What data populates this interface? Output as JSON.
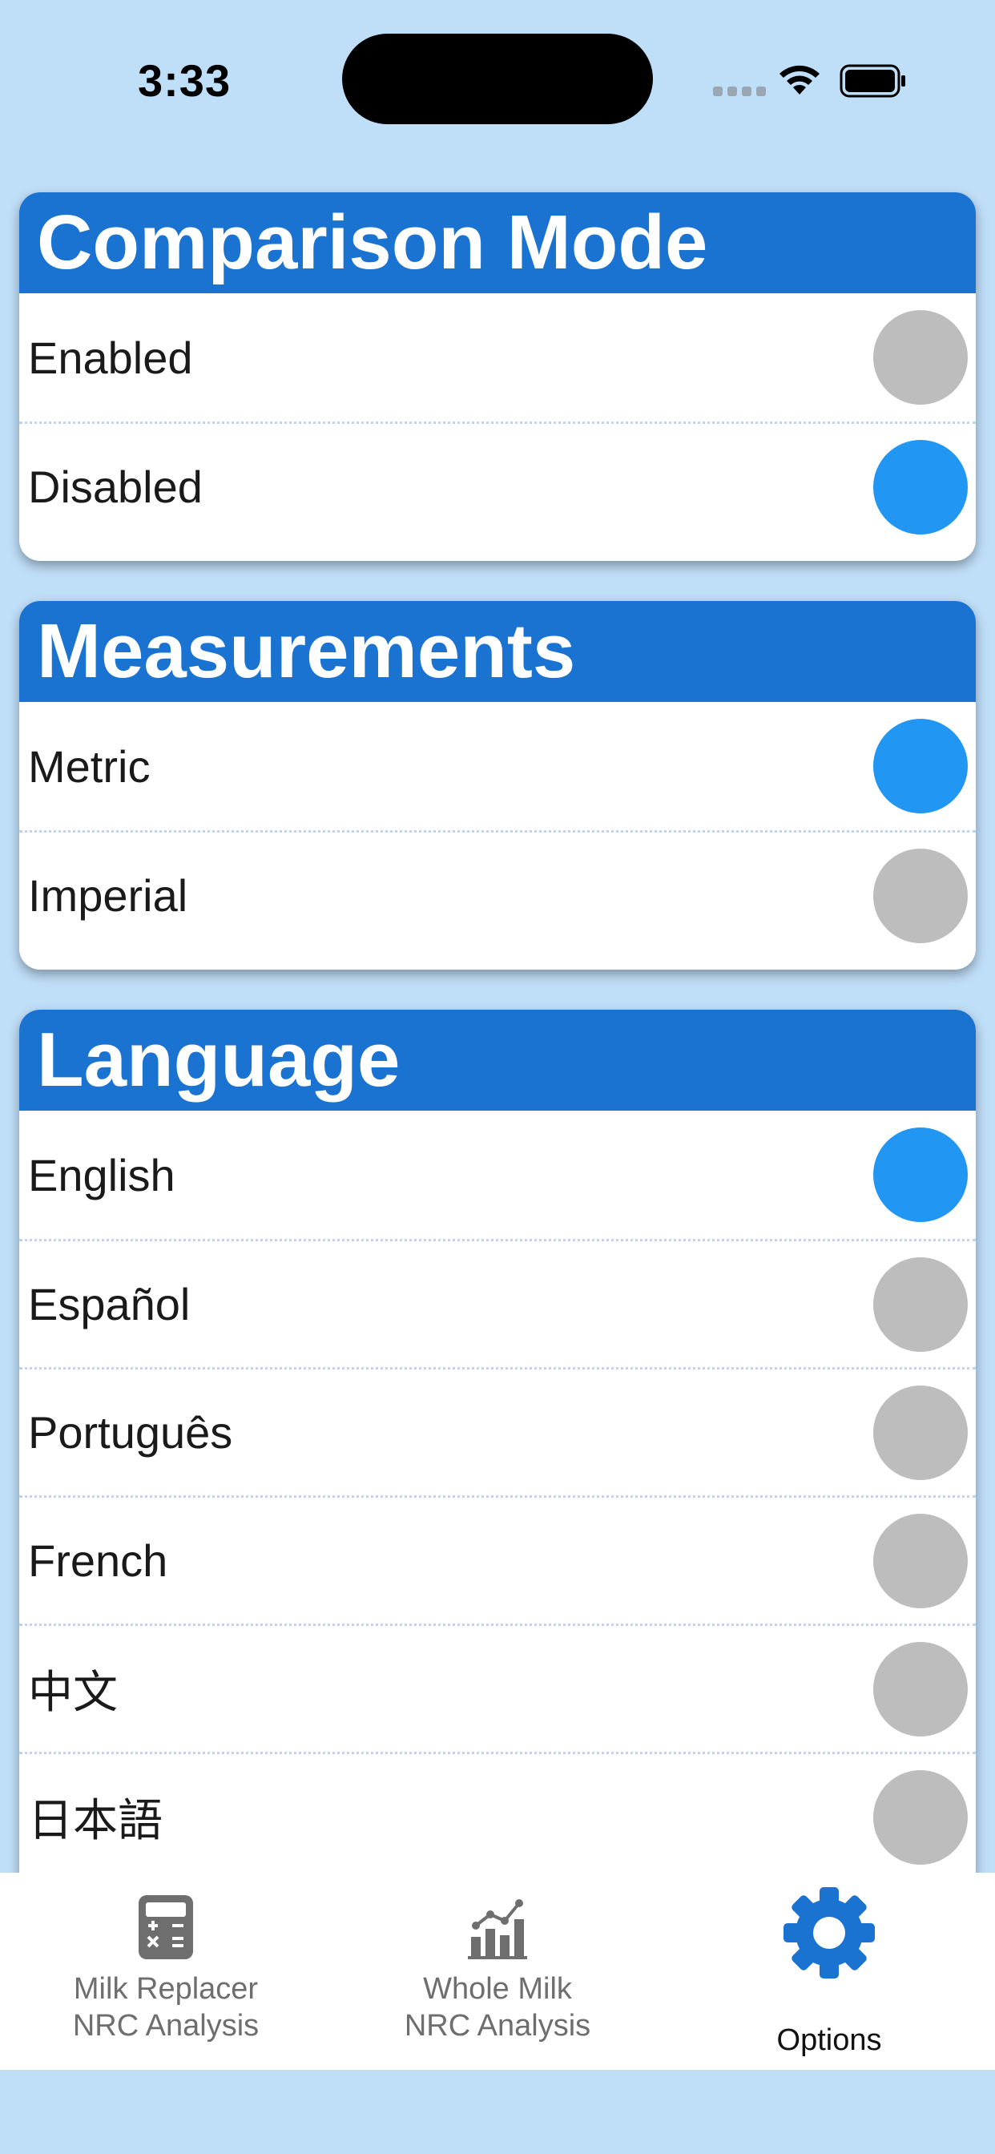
{
  "status_bar": {
    "time": "3:33"
  },
  "comparison_mode": {
    "title": "Comparison Mode",
    "options": [
      {
        "label": "Enabled",
        "selected": false
      },
      {
        "label": "Disabled",
        "selected": true
      }
    ]
  },
  "measurements": {
    "title": "Measurements",
    "options": [
      {
        "label": "Metric",
        "selected": true
      },
      {
        "label": "Imperial",
        "selected": false
      }
    ]
  },
  "language": {
    "title": "Language",
    "options": [
      {
        "label": "English",
        "selected": true
      },
      {
        "label": "Español",
        "selected": false
      },
      {
        "label": "Português",
        "selected": false
      },
      {
        "label": "French",
        "selected": false
      },
      {
        "label": "中文",
        "selected": false
      },
      {
        "label": "日本語",
        "selected": false
      }
    ]
  },
  "tab_bar": {
    "tabs": [
      {
        "label": "Milk Replacer\nNRC Analysis",
        "icon": "calculator-icon",
        "active": false
      },
      {
        "label": "Whole Milk\nNRC Analysis",
        "icon": "chart-icon",
        "active": false
      },
      {
        "label": "Options",
        "icon": "gear-icon",
        "active": true
      }
    ]
  },
  "colors": {
    "background": "#bfdef8",
    "header": "#1a73d1",
    "toggle_on": "#2196f3",
    "toggle_off": "#bdbdbd",
    "tab_active": "#1a73d1",
    "tab_inactive": "#6e6e6e"
  }
}
